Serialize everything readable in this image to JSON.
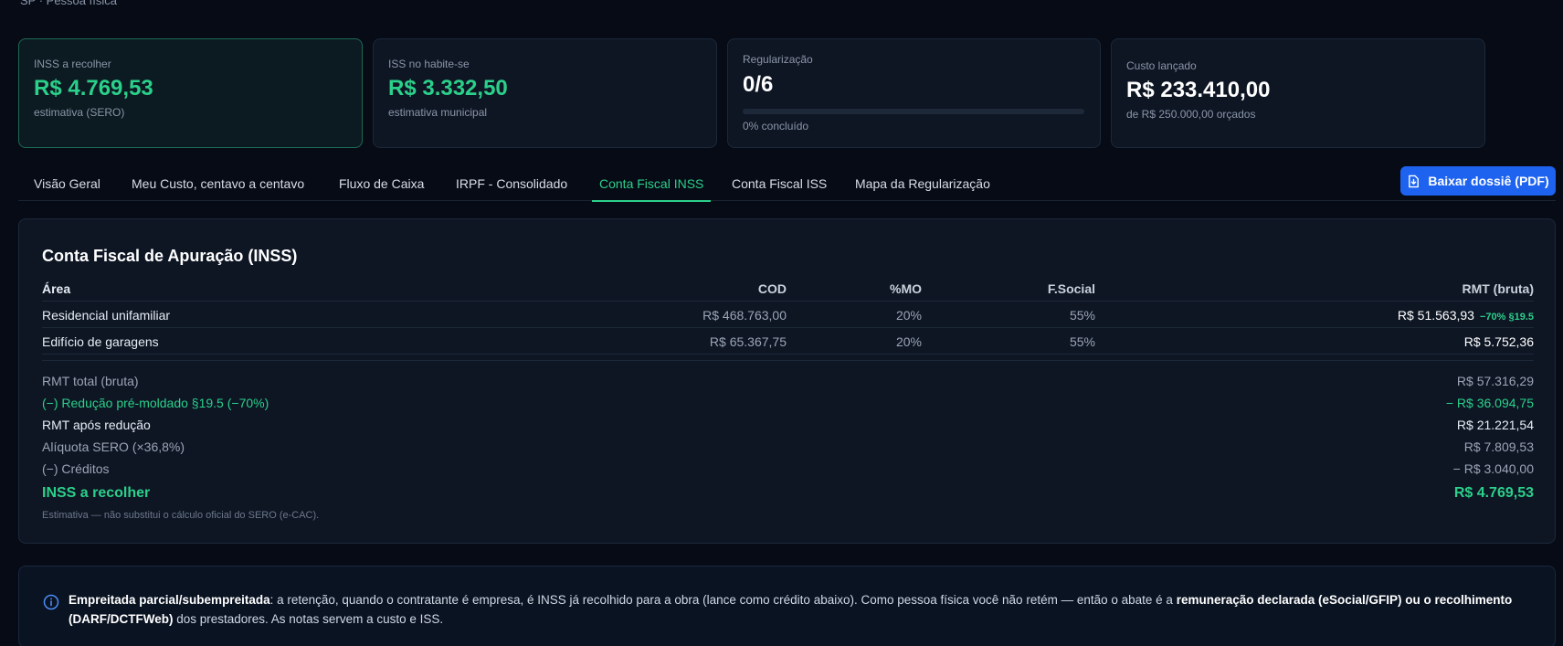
{
  "top_subtitle": "SP · Pessoa física",
  "cards": [
    {
      "label": "INSS a recolher",
      "value": "R$ 4.769,53",
      "sub": "estimativa (SERO)"
    },
    {
      "label": "ISS no habite-se",
      "value": "R$ 3.332,50",
      "sub": "estimativa municipal"
    },
    {
      "label": "Regularização",
      "value": "0/6",
      "sub": "0% concluído",
      "progress_percent": 0
    },
    {
      "label": "Custo lançado",
      "value": "R$ 233.410,00",
      "sub": "de R$ 250.000,00 orçados"
    }
  ],
  "tabs": [
    {
      "label": "Visão Geral"
    },
    {
      "label": "Meu Custo, centavo a centavo"
    },
    {
      "label": "Fluxo de Caixa"
    },
    {
      "label": "IRPF - Consolidado"
    },
    {
      "label": "Conta Fiscal INSS",
      "active": true
    },
    {
      "label": "Conta Fiscal ISS"
    },
    {
      "label": "Mapa da Regularização"
    }
  ],
  "download_button": {
    "label": "Baixar dossiê (PDF)",
    "icon": "file-download-icon"
  },
  "panel": {
    "title": "Conta Fiscal de Apuração (INSS)",
    "columns": [
      "Área",
      "COD",
      "%MO",
      "F.Social",
      "RMT (bruta)"
    ],
    "rows": [
      {
        "area": "Residencial unifamiliar",
        "cod": "R$ 468.763,00",
        "mo": "20%",
        "fsocial": "55%",
        "rmt": "R$ 51.563,93",
        "badge": "−70% §19.5"
      },
      {
        "area": "Edifício de garagens",
        "cod": "R$ 65.367,75",
        "mo": "20%",
        "fsocial": "55%",
        "rmt": "R$ 5.752,36",
        "badge": ""
      }
    ],
    "summary": [
      {
        "label": "RMT total (bruta)",
        "value": "R$ 57.316,29"
      },
      {
        "label": "(−) Redução pré-moldado §19.5 (−70%)",
        "value": "− R$ 36.094,75"
      },
      {
        "label": "RMT após redução",
        "value": "R$ 21.221,54"
      },
      {
        "label": "Alíquota SERO (×36,8%)",
        "value": "R$ 7.809,53"
      },
      {
        "label": "(−) Créditos",
        "value": "− R$ 3.040,00"
      },
      {
        "label": "INSS a recolher",
        "value": "R$ 4.769,53"
      }
    ],
    "note": "Estimativa — não substitui o cálculo oficial do SERO (e-CAC)."
  },
  "info": {
    "icon": "info-icon",
    "bold1": "Empreitada parcial/subempreitada",
    "text1": ": a retenção, quando o contratante é empresa, é INSS já recolhido para a obra (lance como crédito abaixo). Como pessoa física você não retém — então o abate é a ",
    "bold2": "remuneração declarada (eSocial/GFIP) ou o recolhimento (DARF/DCTFWeb)",
    "text2": " dos prestadores. As notas servem a custo e ISS."
  },
  "colors": {
    "accent": "#2bd08a",
    "button": "#1e63f0",
    "background": "#060b16",
    "card": "#0e1624"
  }
}
